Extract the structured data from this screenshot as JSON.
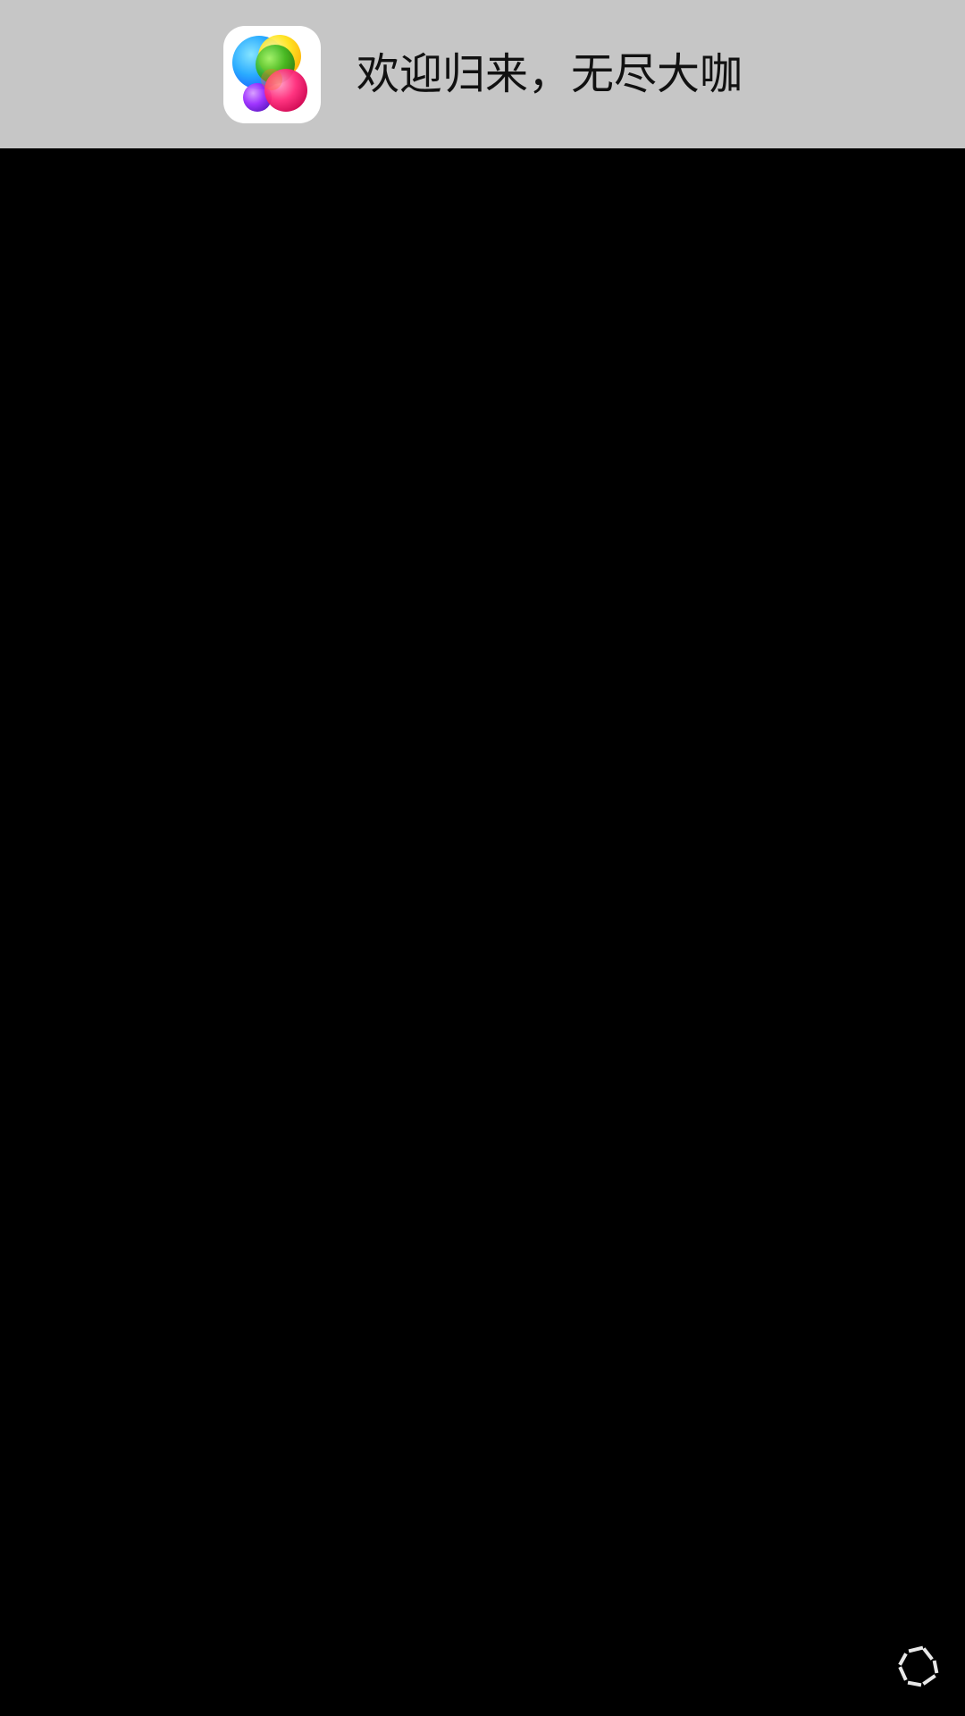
{
  "notification": {
    "app_icon": "game-center-icon",
    "message": "欢迎归来，无尽大咖"
  },
  "screen": {
    "background_color": "#000000",
    "banner_color": "#c6c6c6",
    "loader_icon": "loading-spinner-icon"
  }
}
